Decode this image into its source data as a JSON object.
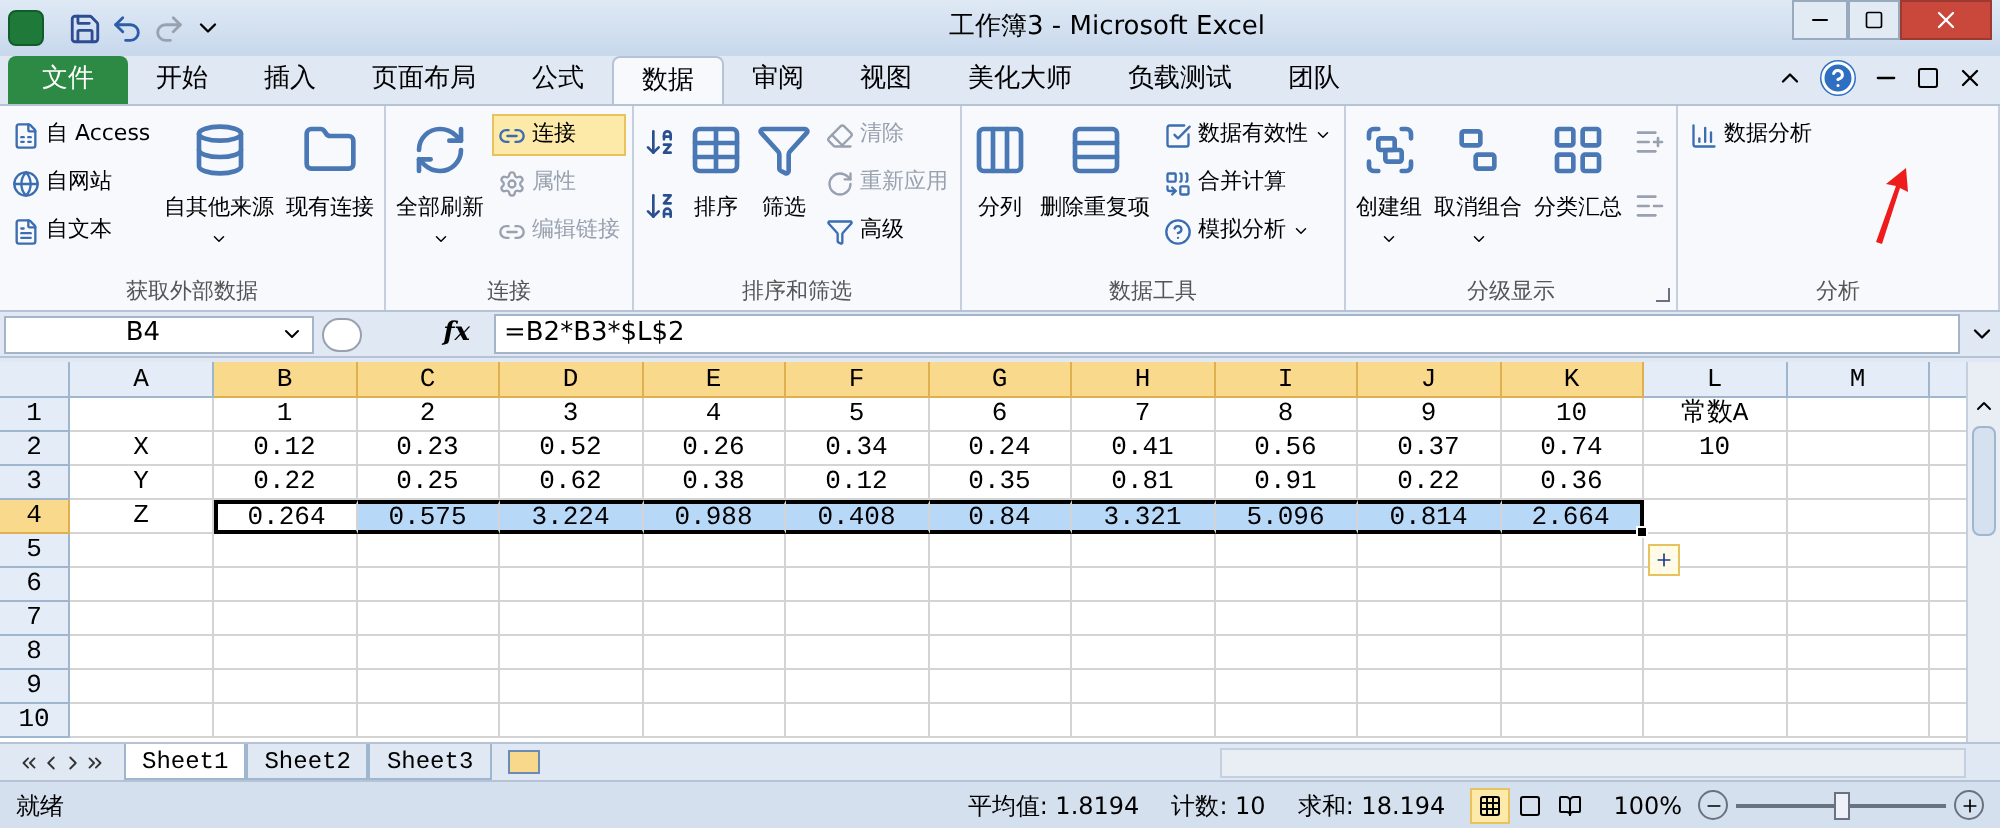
{
  "title_bar": {
    "title": "工作簿3 - Microsoft Excel"
  },
  "menu_tabs": [
    {
      "label": "文件",
      "kind": "file",
      "selected": false
    },
    {
      "label": "开始",
      "kind": "tab",
      "selected": false
    },
    {
      "label": "插入",
      "kind": "tab",
      "selected": false
    },
    {
      "label": "页面布局",
      "kind": "tab",
      "selected": false
    },
    {
      "label": "公式",
      "kind": "tab",
      "selected": false
    },
    {
      "label": "数据",
      "kind": "tab",
      "selected": true
    },
    {
      "label": "审阅",
      "kind": "tab",
      "selected": false
    },
    {
      "label": "视图",
      "kind": "tab",
      "selected": false
    },
    {
      "label": "美化大师",
      "kind": "tab",
      "selected": false
    },
    {
      "label": "负载测试",
      "kind": "tab",
      "selected": false
    },
    {
      "label": "团队",
      "kind": "tab",
      "selected": false
    }
  ],
  "ribbon_groups": [
    {
      "label": "获取外部数据",
      "launcher": false,
      "columns": [
        {
          "kind": "small",
          "items": [
            {
              "label": "自 Access",
              "disabled": false,
              "dropdown": false,
              "selected": false
            },
            {
              "label": "自网站",
              "disabled": false,
              "dropdown": false,
              "selected": false
            },
            {
              "label": "自文本",
              "disabled": false,
              "dropdown": false,
              "selected": false
            }
          ]
        },
        {
          "kind": "large",
          "items": [
            {
              "label": "自其他来源",
              "disabled": false,
              "dropdown": true,
              "selected": false
            }
          ]
        },
        {
          "kind": "large",
          "items": [
            {
              "label": "现有连接",
              "disabled": false,
              "dropdown": false,
              "selected": false
            }
          ]
        }
      ]
    },
    {
      "label": "连接",
      "launcher": false,
      "columns": [
        {
          "kind": "large",
          "items": [
            {
              "label": "全部刷新",
              "disabled": false,
              "dropdown": true,
              "selected": false
            }
          ]
        },
        {
          "kind": "small",
          "items": [
            {
              "label": "连接",
              "disabled": false,
              "dropdown": false,
              "selected": true
            },
            {
              "label": "属性",
              "disabled": true,
              "dropdown": false,
              "selected": false
            },
            {
              "label": "编辑链接",
              "disabled": true,
              "dropdown": false,
              "selected": false
            }
          ]
        }
      ]
    },
    {
      "label": "排序和筛选",
      "launcher": false,
      "columns": [
        {
          "kind": "icons",
          "items": [
            {
              "disabled": false
            },
            {
              "disabled": false
            }
          ]
        },
        {
          "kind": "large",
          "items": [
            {
              "label": "排序",
              "disabled": false,
              "dropdown": false,
              "selected": false
            }
          ]
        },
        {
          "kind": "large",
          "items": [
            {
              "label": "筛选",
              "disabled": false,
              "dropdown": false,
              "selected": false
            }
          ]
        },
        {
          "kind": "small",
          "items": [
            {
              "label": "清除",
              "disabled": true,
              "dropdown": false,
              "selected": false
            },
            {
              "label": "重新应用",
              "disabled": true,
              "dropdown": false,
              "selected": false
            },
            {
              "label": "高级",
              "disabled": false,
              "dropdown": false,
              "selected": false
            }
          ]
        }
      ]
    },
    {
      "label": "数据工具",
      "launcher": false,
      "columns": [
        {
          "kind": "large",
          "items": [
            {
              "label": "分列",
              "disabled": false,
              "dropdown": false,
              "selected": false
            }
          ]
        },
        {
          "kind": "large",
          "items": [
            {
              "label": "删除重复项",
              "disabled": false,
              "dropdown": false,
              "selected": false
            }
          ]
        },
        {
          "kind": "small",
          "items": [
            {
              "label": "数据有效性",
              "disabled": false,
              "dropdown": true,
              "selected": false
            },
            {
              "label": "合并计算",
              "disabled": false,
              "dropdown": false,
              "selected": false
            },
            {
              "label": "模拟分析",
              "disabled": false,
              "dropdown": true,
              "selected": false
            }
          ]
        }
      ]
    },
    {
      "label": "分级显示",
      "launcher": true,
      "columns": [
        {
          "kind": "large",
          "items": [
            {
              "label": "创建组",
              "disabled": false,
              "dropdown": true,
              "selected": false
            }
          ]
        },
        {
          "kind": "large",
          "items": [
            {
              "label": "取消组合",
              "disabled": false,
              "dropdown": true,
              "selected": false
            }
          ]
        },
        {
          "kind": "large",
          "items": [
            {
              "label": "分类汇总",
              "disabled": false,
              "dropdown": false,
              "selected": false
            }
          ]
        },
        {
          "kind": "icons",
          "items": [
            {
              "disabled": true
            },
            {
              "disabled": true
            }
          ]
        }
      ]
    },
    {
      "label": "分析",
      "launcher": false,
      "columns": [
        {
          "kind": "small",
          "items": [
            {
              "label": "数据分析",
              "disabled": false,
              "dropdown": false,
              "selected": false
            }
          ]
        }
      ]
    }
  ],
  "formula_bar": {
    "name_box": "B4",
    "fx": "fx",
    "formula": "=B2*B3*$L$2"
  },
  "sheet": {
    "columns": [
      {
        "label": "A",
        "selected": false
      },
      {
        "label": "B",
        "selected": true
      },
      {
        "label": "C",
        "selected": true
      },
      {
        "label": "D",
        "selected": true
      },
      {
        "label": "E",
        "selected": true
      },
      {
        "label": "F",
        "selected": true
      },
      {
        "label": "G",
        "selected": true
      },
      {
        "label": "H",
        "selected": true
      },
      {
        "label": "I",
        "selected": true
      },
      {
        "label": "J",
        "selected": true
      },
      {
        "label": "K",
        "selected": true
      },
      {
        "label": "L",
        "selected": false
      },
      {
        "label": "M",
        "selected": false
      }
    ],
    "rows": [
      {
        "label": "1",
        "selected": false,
        "cells": [
          null,
          "1",
          "2",
          "3",
          "4",
          "5",
          "6",
          "7",
          "8",
          "9",
          "10",
          "常数A"
        ]
      },
      {
        "label": "2",
        "selected": false,
        "cells": [
          "X",
          "0.12",
          "0.23",
          "0.52",
          "0.26",
          "0.34",
          "0.24",
          "0.41",
          "0.56",
          "0.37",
          "0.74",
          "10"
        ]
      },
      {
        "label": "3",
        "selected": false,
        "cells": [
          "Y",
          "0.22",
          "0.25",
          "0.62",
          "0.38",
          "0.12",
          "0.35",
          "0.81",
          "0.91",
          "0.22",
          "0.36"
        ]
      },
      {
        "label": "4",
        "selected": true,
        "cells": [
          {
            "text": "Z",
            "selected": false,
            "active": false
          },
          {
            "text": "0.264",
            "selected": true,
            "active": true
          },
          {
            "text": "0.575",
            "selected": true,
            "active": false
          },
          {
            "text": "3.224",
            "selected": true,
            "active": false
          },
          {
            "text": "0.988",
            "selected": true,
            "active": false
          },
          {
            "text": "0.408",
            "selected": true,
            "active": false
          },
          {
            "text": "0.84",
            "selected": true,
            "active": false
          },
          {
            "text": "3.321",
            "selected": true,
            "active": false
          },
          {
            "text": "5.096",
            "selected": true,
            "active": false
          },
          {
            "text": "0.814",
            "selected": true,
            "active": false
          },
          {
            "text": "2.664",
            "selected": true,
            "active": false
          }
        ]
      },
      {
        "label": "5",
        "selected": false
      },
      {
        "label": "6",
        "selected": false
      },
      {
        "label": "7",
        "selected": false
      },
      {
        "label": "8",
        "selected": false
      },
      {
        "label": "9",
        "selected": false
      },
      {
        "label": "10",
        "selected": false
      }
    ]
  },
  "sheet_tabs": [
    {
      "label": "Sheet1",
      "selected": true
    },
    {
      "label": "Sheet2",
      "selected": false
    },
    {
      "label": "Sheet3",
      "selected": false
    }
  ],
  "status_bar": {
    "mode": "就绪",
    "average": "平均值: 1.8194",
    "count": "计数: 10",
    "sum": "求和: 18.194",
    "views": [
      {
        "kind": "normal",
        "selected": true
      },
      {
        "kind": "layout",
        "selected": false
      },
      {
        "kind": "pagebreak",
        "selected": false
      }
    ],
    "zoom": "100%",
    "zoom_slider": {
      "level": 0.5
    }
  }
}
